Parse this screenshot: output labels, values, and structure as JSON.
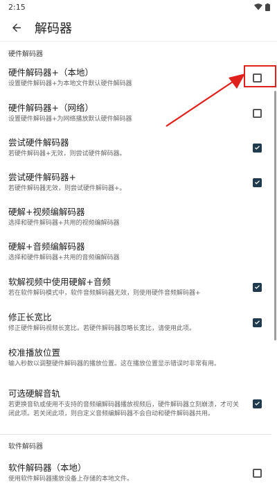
{
  "status_bar": {
    "time": "2:15"
  },
  "header": {
    "title": "解码器"
  },
  "sections": {
    "hardware": {
      "title": "硬件解码器",
      "items": [
        {
          "title": "硬件解码器+（本地）",
          "summary": "设置硬件解码器+为本地文件默认硬件解码器",
          "checked": false
        },
        {
          "title": "硬件解码器+（网络）",
          "summary": "设置硬件解码器+为网络播放默认硬件解码器",
          "checked": false
        },
        {
          "title": "尝试硬件解码器",
          "summary": "若硬件解码器+无效，则尝试硬件解码器。",
          "checked": true
        },
        {
          "title": "尝试硬件解码器+",
          "summary": "若硬件解码器无效，则尝试硬件解码器+。",
          "checked": true
        },
        {
          "title": "硬解+视频编解码器",
          "summary": "选择和硬件解码器+共用的视频编解码器"
        },
        {
          "title": "硬解+音频编解码器",
          "summary": "选择和硬件解码器+共用的音频编解码器"
        },
        {
          "title": "软解视频中使用硬解+音频",
          "summary": "若在软件解码模式中，软件音频解码器无效，则使用硬件音频解码器+",
          "checked": true
        },
        {
          "title": "修正长宽比",
          "summary": "修正硬件解码视频长宽比。若硬件解码器忽略长宽比，请使用此项。",
          "checked": true
        },
        {
          "title": "校准播放位置",
          "summary": "输入秒数以调整硬件解码器的播放位置。这在播放位置显示错误时非常有用。"
        },
        {
          "title": "可选硬解音轨",
          "summary": "若更换音轨或使用不支持的音频编解码器播放视频后，硬件解码器立刻崩溃，才可关闭此项。若关闭此项，则自定义音频编解码器不会自动和硬件解码器共用。",
          "checked": true
        }
      ]
    },
    "software": {
      "title": "软件解码器",
      "items": [
        {
          "title": "软件解码器（本地）",
          "summary": "使用软件解码器播放设备上存储的本地文件。",
          "checked": false
        }
      ]
    }
  },
  "colors": {
    "checked": "#1f3b4d",
    "annotation": "#e0201b"
  }
}
